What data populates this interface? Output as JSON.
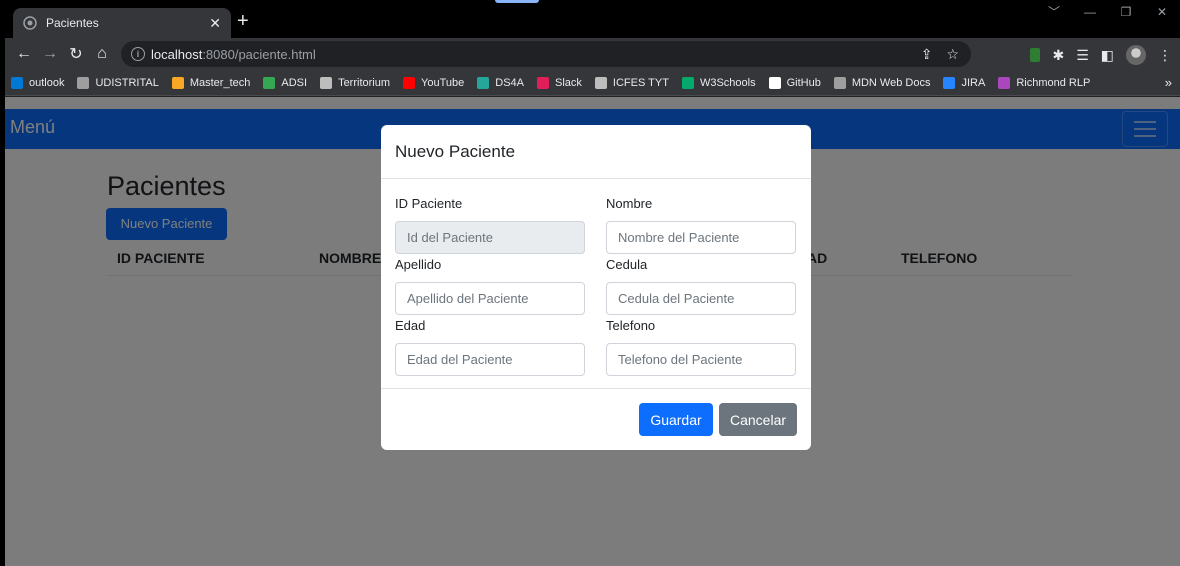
{
  "browser": {
    "tab_title": "Pacientes",
    "new_tab": "+",
    "url_host": "localhost",
    "url_path": ":8080/paciente.html",
    "bookmarks": [
      {
        "label": "outlook",
        "color": "#0078d4"
      },
      {
        "label": "UDISTRITAL",
        "color": "#9e9e9e"
      },
      {
        "label": "Master_tech",
        "color": "#f9a825"
      },
      {
        "label": "ADSI",
        "color": "#34a853"
      },
      {
        "label": "Territorium",
        "color": "#bdbdbd"
      },
      {
        "label": "YouTube",
        "color": "#ff0000"
      },
      {
        "label": "DS4A",
        "color": "#26a69a"
      },
      {
        "label": "Slack",
        "color": "#e01e5a"
      },
      {
        "label": "ICFES TYT",
        "color": "#bdbdbd"
      },
      {
        "label": "W3Schools",
        "color": "#04aa6d"
      },
      {
        "label": "GitHub",
        "color": "#ffffff"
      },
      {
        "label": "MDN Web Docs",
        "color": "#9e9e9e"
      },
      {
        "label": "JIRA",
        "color": "#2684ff"
      },
      {
        "label": "Richmond RLP",
        "color": "#ab47bc"
      }
    ],
    "more": "»"
  },
  "page": {
    "brand": "Menú",
    "title": "Pacientes",
    "new_button": "Nuevo Paciente",
    "columns": [
      "ID PACIENTE",
      "NOMBRE",
      "AD",
      "TELEFONO"
    ]
  },
  "modal": {
    "title": "Nuevo Paciente",
    "fields": {
      "id": {
        "label": "ID Paciente",
        "placeholder": "Id del Paciente"
      },
      "nombre": {
        "label": "Nombre",
        "placeholder": "Nombre del Paciente"
      },
      "apellido": {
        "label": "Apellido",
        "placeholder": "Apellido del Paciente"
      },
      "cedula": {
        "label": "Cedula",
        "placeholder": "Cedula del Paciente"
      },
      "edad": {
        "label": "Edad",
        "placeholder": "Edad del Paciente"
      },
      "telefono": {
        "label": "Telefono",
        "placeholder": "Telefono del Paciente"
      }
    },
    "save": "Guardar",
    "cancel": "Cancelar"
  }
}
